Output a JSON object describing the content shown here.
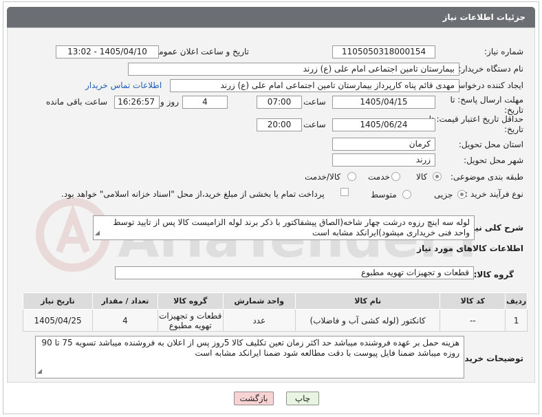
{
  "header": {
    "title": "جزئیات اطلاعات نیاز"
  },
  "form": {
    "need_number_label": "شماره نیاز:",
    "need_number": "1105050318000154",
    "announce_label": "تاریخ و ساعت اعلان عمومی:",
    "announce_value": "1405/04/10 - 13:02",
    "buyer_label": "نام دستگاه خریدار:",
    "buyer_value": "بیمارستان تامین اجتماعی امام علی (ع) زرند",
    "creator_label": "ایجاد کننده درخواست:",
    "creator_value": "مهدی  قائم پناه  کارپرداز بیمارستان تامین اجتماعی امام علی (ع) زرند",
    "contact_link": "اطلاعات تماس خریدار",
    "deadline_label": "مهلت ارسال پاسخ: تا تاریخ:",
    "deadline_date": "1405/04/15",
    "time_label": "ساعت",
    "deadline_time": "07:00",
    "days_value": "4",
    "days_label": "روز و",
    "remaining_value": "16:26:57",
    "remaining_label": "ساعت باقی مانده",
    "price_validity_label": "حداقل تاریخ اعتبار قیمت: تا تاریخ:",
    "price_date": "1405/06/24",
    "price_time": "20:00",
    "province_label": "استان محل تحویل:",
    "province_value": "کرمان",
    "city_label": "شهر محل تحویل:",
    "city_value": "زرند",
    "category_label": "طبقه بندی موضوعی:",
    "category_options": [
      "کالا",
      "خدمت",
      "کالا/خدمت"
    ],
    "category_selected": "کالا",
    "process_label": "نوع فرآیند خرید :",
    "process_options": [
      "جزیی",
      "متوسط"
    ],
    "process_selected": "جزیی",
    "payment_note": "پرداخت تمام یا بخشی از مبلغ خرید،از محل \"اسناد خزانه اسلامی\" خواهد بود."
  },
  "description": {
    "label": "شرح کلی نیاز:",
    "text": "لوله سه اینچ رزوه درشت چهار شاخه(الصاق پیشفاکتور با ذکر برند لوله الزامیست کالا پس از تایید توسط واحد فنی خریداری میشود)ایرانکد مشابه است"
  },
  "goods": {
    "section_title": "اطلاعات کالاهای مورد نیاز",
    "group_label": "گروه کالا:",
    "group_value": "قطعات و تجهیزات تهویه مطبوع",
    "columns": [
      "ردیف",
      "کد کالا",
      "نام کالا",
      "واحد شمارش",
      "گروه کالا",
      "تعداد / مقدار",
      "تاریخ نیاز"
    ],
    "rows": [
      {
        "row": "1",
        "code": "--",
        "name": "کانکتور (لوله کشی آب و فاضلاب)",
        "unit": "عدد",
        "group": "قطعات و تجهیزات تهویه مطبوع",
        "qty": "4",
        "date": "1405/04/25"
      }
    ]
  },
  "buyer_notes": {
    "label": "توضیحات خریدار:",
    "text": "هزینه حمل بر عهده فروشنده میباشد حد اکثر زمان تعین تکلیف کالا 5روز پس از اعلان به فروشنده میباشد تسویه 75 تا 90 روزه میباشد ضمنا فایل پیوست با دقت مطالعه شود ضمنا ایرانکد مشابه است"
  },
  "buttons": {
    "print": "چاپ",
    "back": "بازگشت"
  },
  "watermark_text": "AriaTender.neT",
  "colors": {
    "header_bg": "#6b6e72",
    "link": "#1f5fb8",
    "back_btn": "#f9d3d3",
    "print_btn": "#e8f5e0"
  }
}
